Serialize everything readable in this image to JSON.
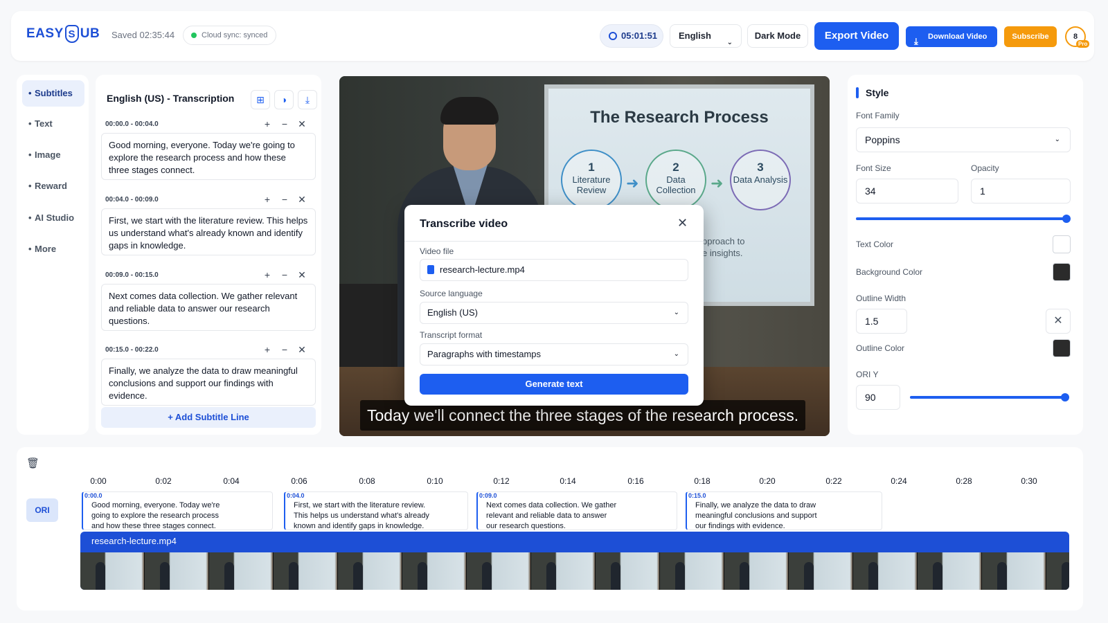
{
  "header": {
    "logo_pre": "EASY",
    "logo_mark": "S",
    "logo_post": "UB",
    "saved": "Saved 02:35:44",
    "sync": "Cloud sync: synced",
    "timer": "05:01:51",
    "language": "English",
    "dark_mode": "Dark Mode",
    "export": "Export Video",
    "download": "Download Video",
    "subscribe": "Subscribe",
    "avatar_count": "8",
    "avatar_badge": "Pro"
  },
  "nav": [
    "Subtitles",
    "Text",
    "Image",
    "Reward",
    "AI Studio",
    "More"
  ],
  "subtitles": {
    "title": "English (US) - Transcription",
    "entries": [
      {
        "time": "00:00.0 - 00:04.0",
        "text": "Good morning, everyone. Today we're going to explore the research process and how these three stages connect."
      },
      {
        "time": "00:04.0 - 00:09.0",
        "text": "First, we start with the literature review. This helps us understand what's already known and identify gaps in knowledge."
      },
      {
        "time": "00:09.0 - 00:15.0",
        "text": "Next comes data collection. We gather relevant and reliable data to answer our research questions."
      },
      {
        "time": "00:15.0 - 00:22.0",
        "text": "Finally, we analyze the data to draw meaningful conclusions and support our findings with evidence."
      }
    ],
    "add_line": "+ Add Subtitle Line"
  },
  "video": {
    "slide_title": "The Research Process",
    "stages": [
      {
        "n": "1",
        "label": "Literature Review"
      },
      {
        "n": "2",
        "label": "Data Collection"
      },
      {
        "n": "3",
        "label": "Data Analysis"
      }
    ],
    "slide_text_1": "pproach to",
    "slide_text_2": "e insights.",
    "caption": "Today we'll connect the three stages of the research process."
  },
  "modal": {
    "title": "Transcribe video",
    "video_file_label": "Video file",
    "video_file": "research-lecture.mp4",
    "source_label": "Source language",
    "source_value": "English (US)",
    "format_label": "Transcript format",
    "format_value": "Paragraphs with timestamps",
    "generate": "Generate text"
  },
  "style": {
    "title": "Style",
    "font_family_label": "Font Family",
    "font_family": "Poppins",
    "font_size_label": "Font Size",
    "font_size": "34",
    "opacity_label": "Opacity",
    "opacity": "1",
    "opacity_level": 1.0,
    "text_color_label": "Text Color",
    "text_color": "#ffffff",
    "bg_color_label": "Background Color",
    "bg_color": "#2b2b2b",
    "outline_width_label": "Outline Width",
    "outline_width": "1.5",
    "outline_color_label": "Outline Color",
    "outline_color": "#2b2b2b",
    "ori_y_label": "ORI Y",
    "ori_y": "90",
    "ori_y_level": 1.0
  },
  "timeline": {
    "ticks": [
      "0:00",
      "0:02",
      "0:04",
      "0:06",
      "0:08",
      "0:10",
      "0:12",
      "0:14",
      "0:16",
      "0:18",
      "0:20",
      "0:22",
      "0:24",
      "0:28",
      "0:30"
    ],
    "track_label": "ORI",
    "segments": [
      {
        "start": "0:00.0",
        "lines": [
          "Good morning, everyone. Today we're",
          "going to explore the research process",
          "and how these three stages connect."
        ]
      },
      {
        "start": "0:04.0",
        "lines": [
          "First, we start with the literature review.",
          "This helps us understand what's already",
          "known and identify gaps in knowledge."
        ]
      },
      {
        "start": "0:09.0",
        "lines": [
          "Next comes data collection. We gather",
          "relevant and reliable data to answer",
          "our research questions."
        ]
      },
      {
        "start": "0:15.0",
        "lines": [
          "Finally, we analyze the data to draw",
          "meaningful conclusions and support",
          "our findings with evidence."
        ]
      }
    ],
    "video_name": "research-lecture.mp4"
  },
  "colors": {
    "accent": "#1d5ef0",
    "subscribe": "#f59a0c",
    "sync_ok": "#22c55e"
  }
}
